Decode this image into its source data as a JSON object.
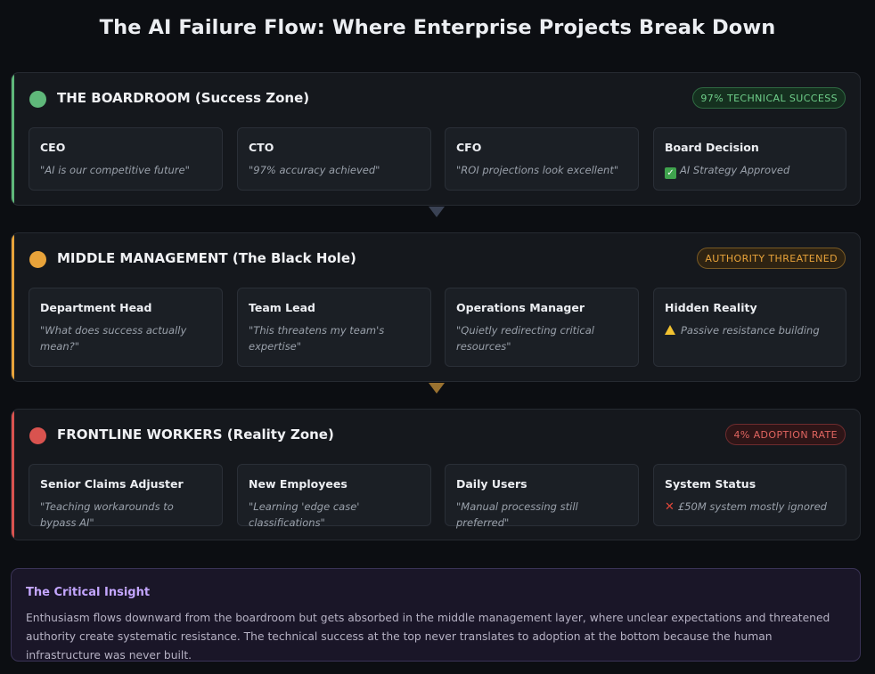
{
  "title": "The AI Failure Flow: Where Enterprise Projects Break Down",
  "colors": {
    "success": "#5fb87a",
    "warning": "#e8a33a",
    "danger": "#d9534f",
    "insight_accent": "#c4a6ff"
  },
  "tiers": [
    {
      "title": "THE BOARDROOM (Success Zone)",
      "badge": "97% TECHNICAL SUCCESS",
      "cards": [
        {
          "role": "CEO",
          "quote": "\"AI is our competitive future\""
        },
        {
          "role": "CTO",
          "quote": "\"97% accuracy achieved\""
        },
        {
          "role": "CFO",
          "quote": "\"ROI projections look excellent\""
        },
        {
          "role": "Board Decision",
          "icon": "check-icon",
          "quote": "AI Strategy Approved"
        }
      ]
    },
    {
      "title": "MIDDLE MANAGEMENT (The Black Hole)",
      "badge": "AUTHORITY THREATENED",
      "cards": [
        {
          "role": "Department Head",
          "quote": "\"What does success actually mean?\""
        },
        {
          "role": "Team Lead",
          "quote": "\"This threatens my team's expertise\""
        },
        {
          "role": "Operations Manager",
          "quote": "\"Quietly redirecting critical resources\""
        },
        {
          "role": "Hidden Reality",
          "icon": "warning-icon",
          "quote": "Passive resistance building"
        }
      ]
    },
    {
      "title": "FRONTLINE WORKERS (Reality Zone)",
      "badge": "4% ADOPTION RATE",
      "cards": [
        {
          "role": "Senior Claims Adjuster",
          "quote": "\"Teaching workarounds to bypass AI\""
        },
        {
          "role": "New Employees",
          "quote": "\"Learning 'edge case' classifications\""
        },
        {
          "role": "Daily Users",
          "quote": "\"Manual processing still preferred\""
        },
        {
          "role": "System Status",
          "icon": "cross-icon",
          "quote": "£50M system mostly ignored"
        }
      ]
    }
  ],
  "insight": {
    "title": "The Critical Insight",
    "body": "Enthusiasm flows downward from the boardroom but gets absorbed in the middle management layer, where unclear expectations and threatened authority create systematic resistance. The technical success at the top never translates to adoption at the bottom because the human infrastructure was never built."
  }
}
